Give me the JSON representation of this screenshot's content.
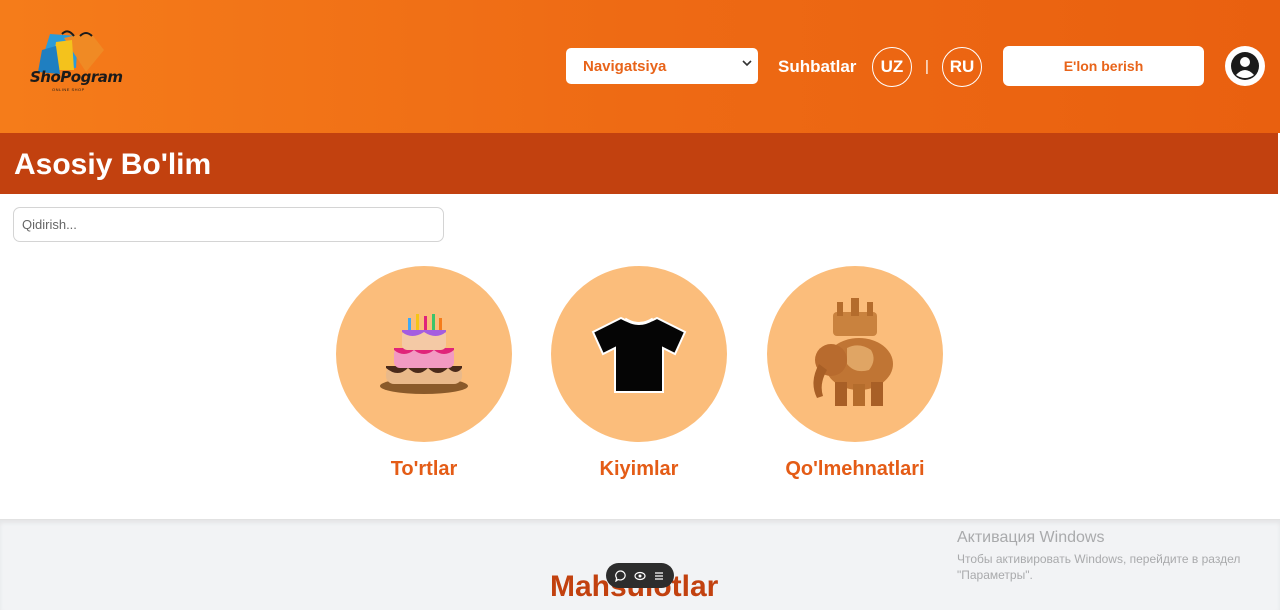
{
  "header": {
    "logo_text": "ShoPogram",
    "logo_subtext": "ONLINE SHOP",
    "nav_select_value": "Navigatsiya",
    "chats_label": "Suhbatlar",
    "lang_uz": "UZ",
    "lang_separator": "|",
    "lang_ru": "RU",
    "post_ad_label": "E'lon berish",
    "profile_icon": "user-circle-icon"
  },
  "section": {
    "title": "Asosiy Bo'lim"
  },
  "search": {
    "placeholder": "Qidirish..."
  },
  "categories": [
    {
      "label": "To'rtlar",
      "icon": "cake-icon"
    },
    {
      "label": "Kiyimlar",
      "icon": "tshirt-icon"
    },
    {
      "label": "Qo'lmehnatlari",
      "icon": "elephant-statue-icon"
    }
  ],
  "products": {
    "title": "Mahsulotlar"
  },
  "float_toolbar": {
    "icons": [
      "chat-icon",
      "eye-icon",
      "menu-icon"
    ]
  },
  "windows_watermark": {
    "title": "Активация Windows",
    "line1": "Чтобы активировать Windows, перейдите в раздел",
    "line2": "\"Параметры\"."
  },
  "colors": {
    "header_orange": "#f07018",
    "section_bar": "#c2410f",
    "category_circle": "#fbbd7b",
    "category_label": "#e45c16"
  }
}
